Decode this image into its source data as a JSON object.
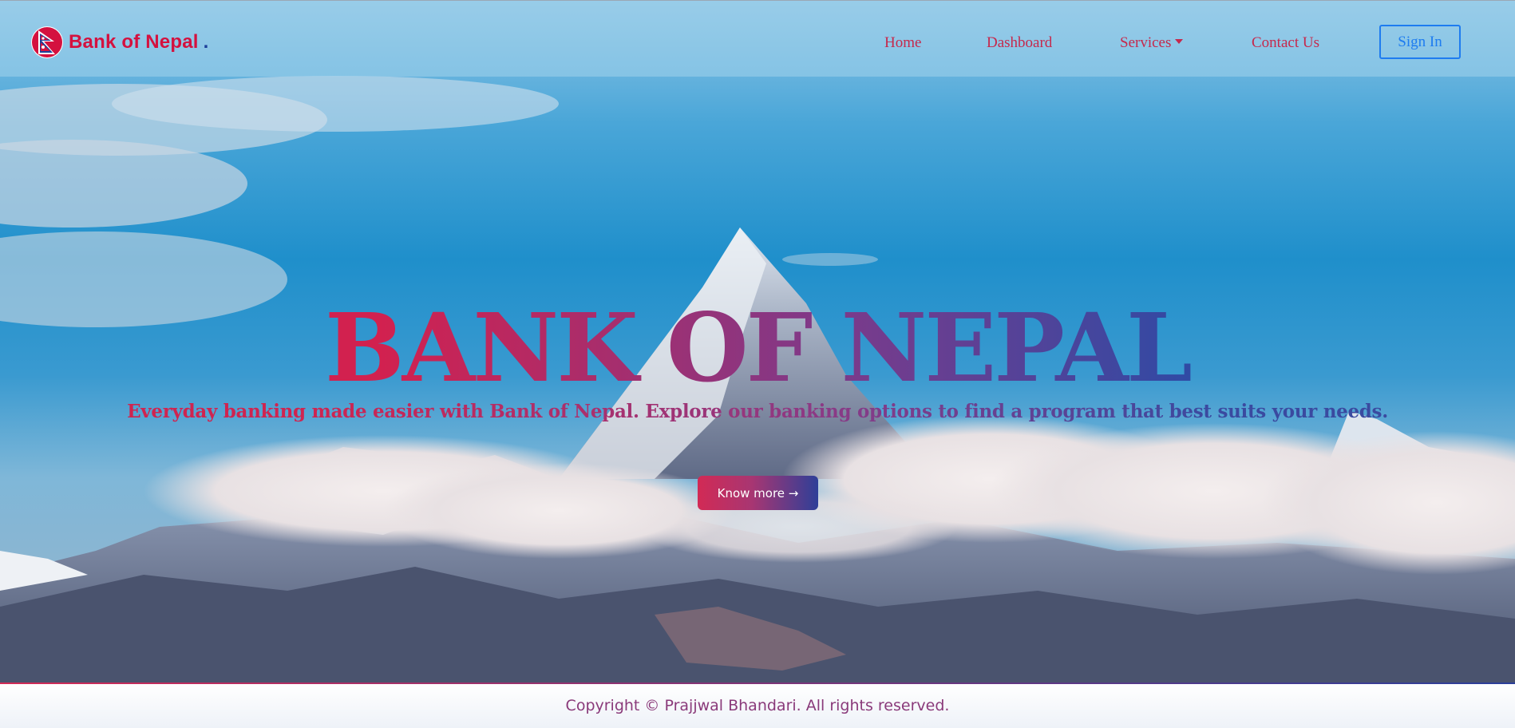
{
  "brand": {
    "name": "Bank of Nepal",
    "dot": "."
  },
  "nav": {
    "home": "Home",
    "dashboard": "Dashboard",
    "services": "Services",
    "contact": "Contact Us",
    "signin": "Sign In"
  },
  "hero": {
    "title": "BANK OF NEPAL",
    "subtitle": "Everyday banking made easier with Bank of Nepal. Explore our banking options to find a program that best suits your needs.",
    "cta": "Know more →"
  },
  "footer": {
    "copyright": "Copyright © Prajjwal Bhandari. All rights reserved."
  },
  "icons": {
    "logo": "nepal-flag-icon",
    "services_caret": "caret-down-icon"
  },
  "colors": {
    "brand_red": "#d4113f",
    "brand_blue": "#1d3f9a",
    "signin_blue": "#1e7cf0",
    "nav_link": "#c6284c"
  }
}
